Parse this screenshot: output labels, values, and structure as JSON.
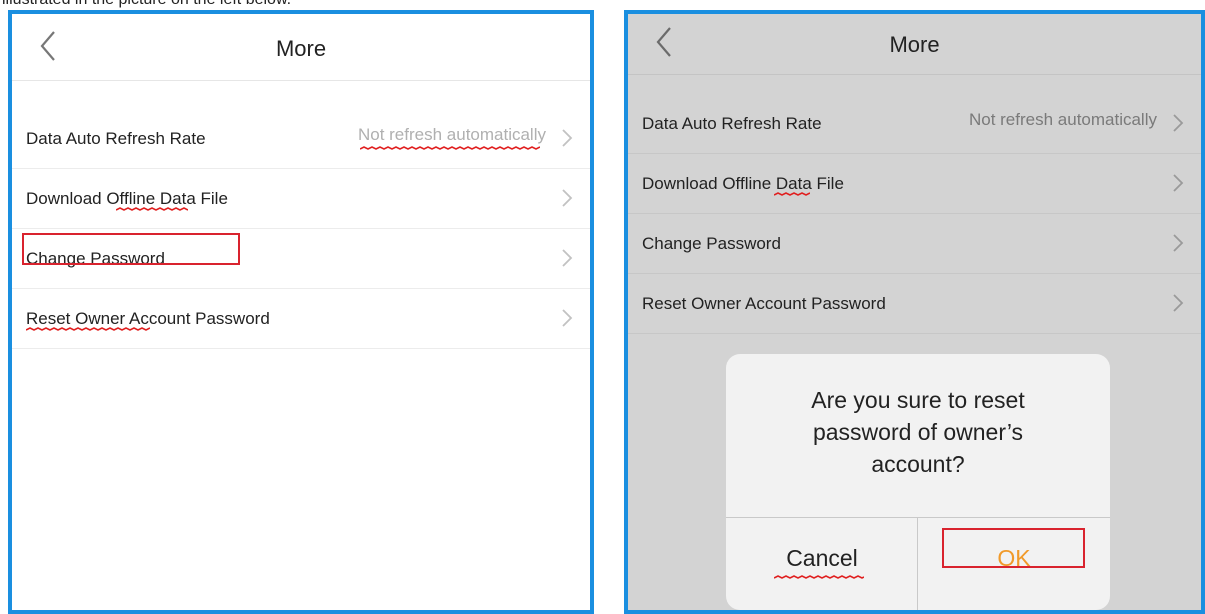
{
  "caption": "illustrated in the picture on the left below.",
  "colors": {
    "panel_border": "#1a8fe0",
    "highlight": "#d9232e",
    "ok_text": "#f19a2a"
  },
  "left_screen": {
    "title": "More",
    "back_icon": "chevron-left-icon",
    "items": [
      {
        "label": "Data Auto Refresh Rate",
        "value": "Not refresh automatically"
      },
      {
        "label": "Download Offline Data File",
        "value": ""
      },
      {
        "label": "Change Password",
        "value": ""
      },
      {
        "label": "Reset Owner Account Password",
        "value": ""
      }
    ]
  },
  "right_screen": {
    "title": "More",
    "back_icon": "chevron-left-icon",
    "items": [
      {
        "label": "Data Auto Refresh Rate",
        "value": "Not refresh automatically"
      },
      {
        "label": "Download Offline Data File",
        "value": ""
      },
      {
        "label": "Change Password",
        "value": ""
      },
      {
        "label": "Reset Owner Account Password",
        "value": ""
      }
    ],
    "dialog": {
      "message_line1": "Are you sure to reset",
      "message_line2": "password of owner’s",
      "message_line3": "account?",
      "cancel_label": "Cancel",
      "ok_label": "OK"
    }
  }
}
